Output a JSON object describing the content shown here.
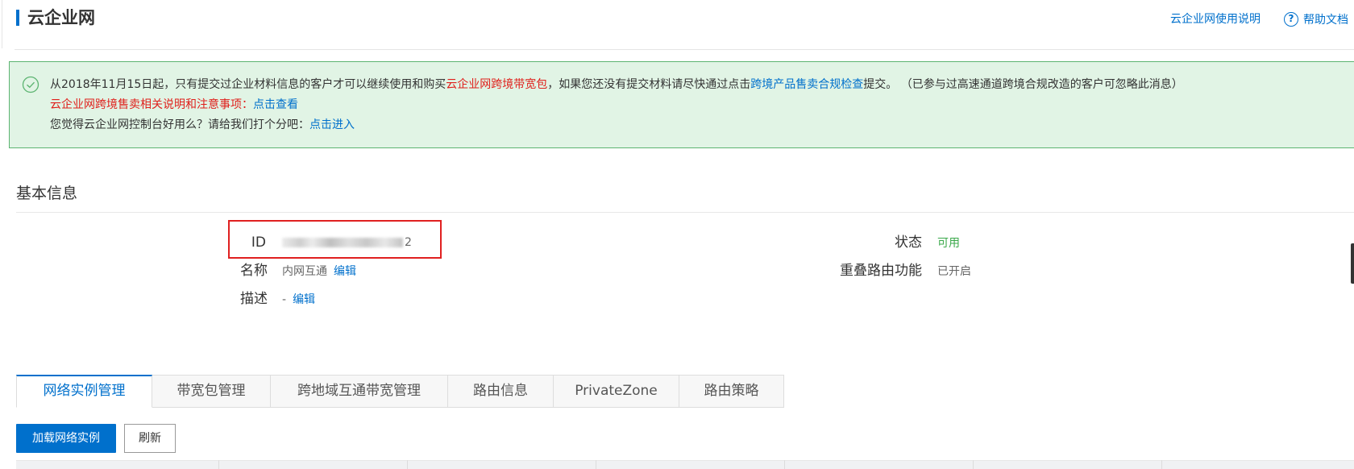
{
  "header": {
    "title": "云企业网",
    "usage_link": "云企业网使用说明",
    "help_link": "帮助文档"
  },
  "notice": {
    "line1": {
      "prefix": "从2018年11月15日起，只有提交过企业材料信息的客户才可以继续使用和购买",
      "highlight": "云企业网跨境带宽包",
      "middle": "，如果您还没有提交材料请尽快通过点击",
      "link": "跨境产品售卖合规检查",
      "suffix": "提交。 （已参与过高速通道跨境合规改造的客户可忽略此消息）"
    },
    "line2": {
      "text": "云企业网跨境售卖相关说明和注意事项：",
      "link": "点击查看"
    },
    "line3": {
      "text": "您觉得云企业网控制台好用么？请给我们打个分吧：",
      "link": "点击进入"
    }
  },
  "basic_info": {
    "title": "基本信息",
    "id": {
      "label": "ID",
      "value_suffix": "2"
    },
    "name": {
      "label": "名称",
      "value": "内网互通",
      "edit": "编辑"
    },
    "description": {
      "label": "描述",
      "value": "-",
      "edit": "编辑"
    },
    "status": {
      "label": "状态",
      "value": "可用"
    },
    "overlap_routing": {
      "label": "重叠路由功能",
      "value": "已开启"
    }
  },
  "tabs": [
    {
      "label": "网络实例管理",
      "active": true
    },
    {
      "label": "带宽包管理",
      "active": false
    },
    {
      "label": "跨地域互通带宽管理",
      "active": false
    },
    {
      "label": "路由信息",
      "active": false
    },
    {
      "label": "PrivateZone",
      "active": false
    },
    {
      "label": "路由策略",
      "active": false
    }
  ],
  "toolbar": {
    "load_button": "加载网络实例",
    "refresh_button": "刷新"
  },
  "colors": {
    "accent": "#0070cc",
    "notice_bg": "#e1f4e5",
    "notice_border": "#5cb471",
    "warning_red": "#e0201c",
    "status_green": "#3aa84a",
    "highlight_box": "#e02020"
  }
}
